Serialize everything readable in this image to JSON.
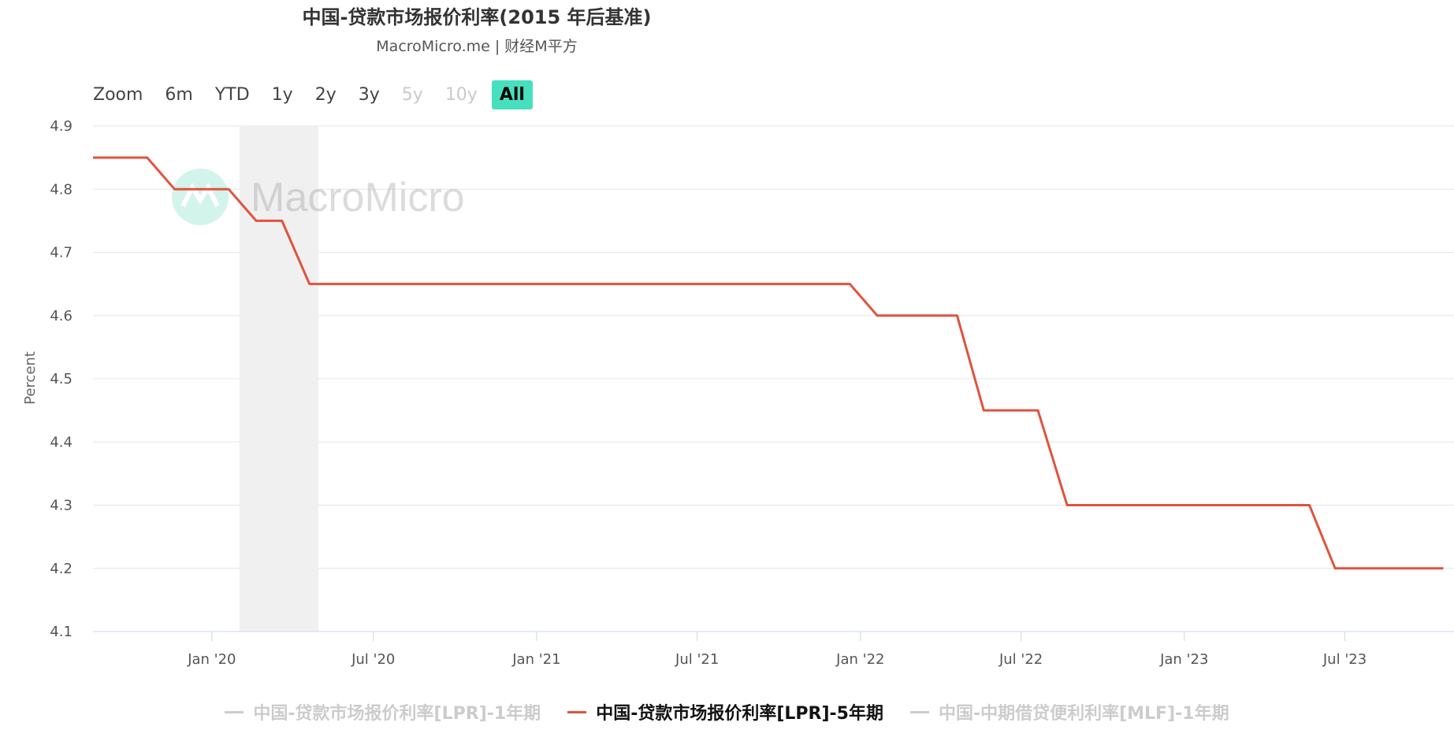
{
  "chart_data": {
    "type": "line",
    "title": "中国-贷款市场报价利率(2015 年后基准)",
    "subtitle": "MacroMicro.me | 财经M平方",
    "ylabel": "Percent",
    "ylim": [
      4.1,
      4.9
    ],
    "yticks": [
      "4.1",
      "4.2",
      "4.3",
      "4.4",
      "4.5",
      "4.6",
      "4.7",
      "4.8",
      "4.9"
    ],
    "xlim": [
      "2019-08-20",
      "2023-11-01"
    ],
    "xticks": [
      {
        "date": "2020-01-01",
        "label": "Jan '20"
      },
      {
        "date": "2020-07-01",
        "label": "Jul '20"
      },
      {
        "date": "2021-01-01",
        "label": "Jan '21"
      },
      {
        "date": "2021-07-01",
        "label": "Jul '21"
      },
      {
        "date": "2022-01-01",
        "label": "Jan '22"
      },
      {
        "date": "2022-07-01",
        "label": "Jul '22"
      },
      {
        "date": "2023-01-01",
        "label": "Jan '23"
      },
      {
        "date": "2023-07-01",
        "label": "Jul '23"
      }
    ],
    "shaded_range": [
      "2020-02-01",
      "2020-04-30"
    ],
    "grid": true,
    "legend_position": "bottom",
    "watermark": "MacroMicro",
    "series": [
      {
        "name": "中国-贷款市场报价利率[LPR]-1年期",
        "color": "#cccccc",
        "visible": false,
        "x": [],
        "y": []
      },
      {
        "name": "中国-贷款市场报价利率[LPR]-5年期",
        "color": "#e0533d",
        "visible": true,
        "x": [
          "2019-08-20",
          "2019-09-20",
          "2019-10-20",
          "2019-11-20",
          "2019-12-20",
          "2020-01-20",
          "2020-02-20",
          "2020-03-20",
          "2020-04-20",
          "2020-05-20",
          "2021-10-20",
          "2021-11-20",
          "2021-12-20",
          "2022-01-20",
          "2022-02-20",
          "2022-03-20",
          "2022-04-20",
          "2022-05-20",
          "2022-06-20",
          "2022-07-20",
          "2022-08-22",
          "2022-09-20",
          "2023-05-22",
          "2023-06-20",
          "2023-07-20",
          "2023-10-20"
        ],
        "y": [
          4.85,
          4.85,
          4.85,
          4.8,
          4.8,
          4.8,
          4.75,
          4.75,
          4.65,
          4.65,
          4.65,
          4.65,
          4.65,
          4.6,
          4.6,
          4.6,
          4.6,
          4.45,
          4.45,
          4.45,
          4.3,
          4.3,
          4.3,
          4.2,
          4.2,
          4.2
        ]
      },
      {
        "name": "中国-中期借贷便利利率[MLF]-1年期",
        "color": "#cccccc",
        "visible": false,
        "x": [],
        "y": []
      }
    ]
  },
  "zoom": {
    "label": "Zoom",
    "buttons": [
      {
        "label": "6m",
        "state": "normal"
      },
      {
        "label": "YTD",
        "state": "normal"
      },
      {
        "label": "1y",
        "state": "normal"
      },
      {
        "label": "2y",
        "state": "normal"
      },
      {
        "label": "3y",
        "state": "normal"
      },
      {
        "label": "5y",
        "state": "disabled"
      },
      {
        "label": "10y",
        "state": "disabled"
      },
      {
        "label": "All",
        "state": "active"
      }
    ]
  }
}
